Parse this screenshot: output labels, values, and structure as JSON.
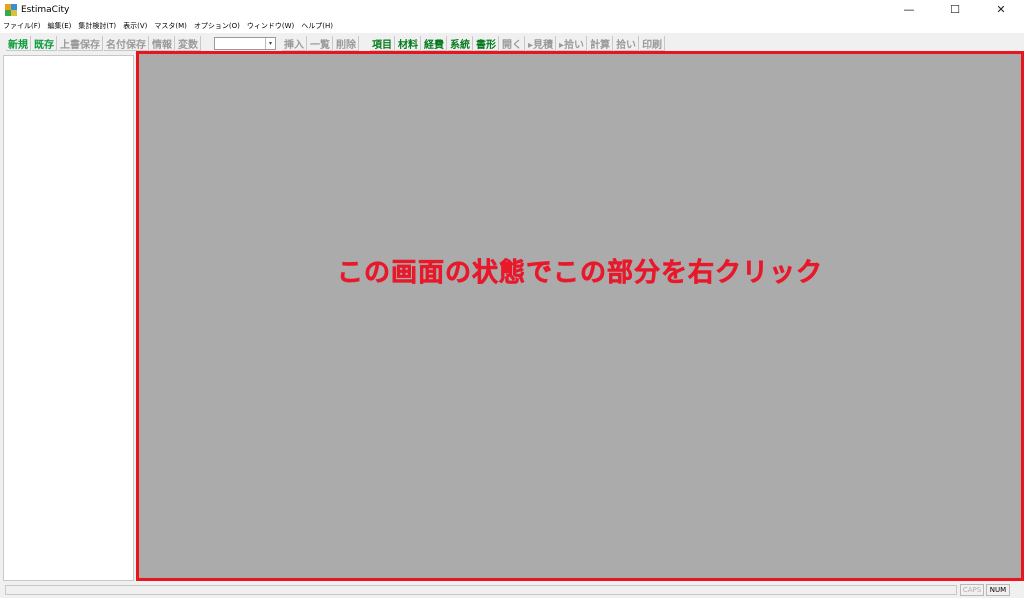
{
  "window": {
    "title": "EstimaCity",
    "minimize": "—",
    "maximize": "☐",
    "close": "✕"
  },
  "menu": [
    "ファイル(F)",
    "編集(E)",
    "集計検討(T)",
    "表示(V)",
    "マスタ(M)",
    "オプション(O)",
    "ウィンドウ(W)",
    "ヘルプ(H)"
  ],
  "toolbar": {
    "new": "新規",
    "existing": "既存",
    "overwrite_save": "上書保存",
    "save_as": "名付保存",
    "info": "情報",
    "variable": "変数",
    "dropdown_value": "",
    "insert": "挿入",
    "list": "一覧",
    "delete": "削除",
    "item": "項目",
    "material": "材料",
    "expense": "経費",
    "system": "系統",
    "form": "書形",
    "open": "開く",
    "estimate": "▸見積",
    "pickup": "▸拾い",
    "calc": "計算",
    "pick": "拾い",
    "print": "印刷"
  },
  "main": {
    "annotation": "この画面の状態でこの部分を右クリック"
  },
  "statusbar": {
    "caps": "CAPS",
    "num": "NUM"
  },
  "colors": {
    "highlight_border": "#e6151e",
    "annotation_text": "#e8192a",
    "enabled_button": "#0a9c3a",
    "disabled_button": "#9a9a9a"
  }
}
